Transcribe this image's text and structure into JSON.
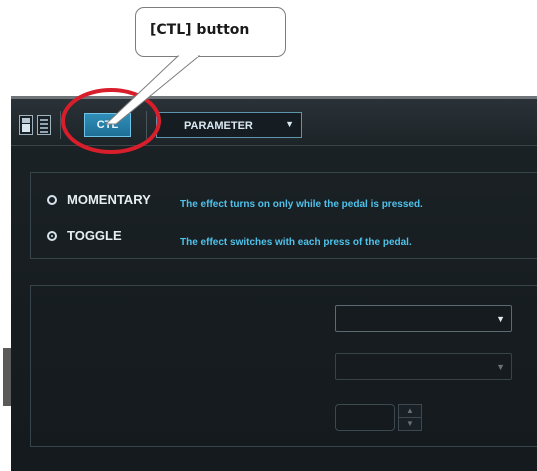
{
  "callout": {
    "text": "[CTL] button"
  },
  "toolbar": {
    "ctl_label": "CTL",
    "parameter_label": "PARAMETER"
  },
  "options": [
    {
      "label": "MOMENTARY",
      "selected": false,
      "description": "The effect turns on only while the pedal is pressed."
    },
    {
      "label": "TOGGLE",
      "selected": true,
      "description": "The effect switches with each press of the pedal."
    }
  ],
  "dropdowns": [
    {
      "value": "",
      "enabled": true
    },
    {
      "value": "",
      "enabled": false
    }
  ],
  "number_field": {
    "value": ""
  },
  "icons": {
    "single_view": "single-view-icon",
    "multi_view": "list-view-icon",
    "dropdown_arrow": "triangle-down-icon",
    "stepper_up": "triangle-up-icon",
    "stepper_down": "triangle-down-icon"
  },
  "colors": {
    "highlight_ring": "#d91e2b",
    "accent": "#4fc2ea",
    "ctl_button": "#2a86b0"
  }
}
